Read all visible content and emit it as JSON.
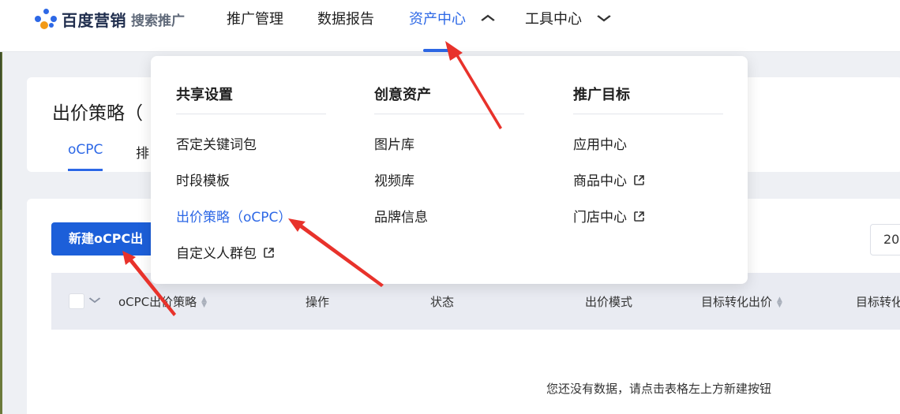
{
  "header": {
    "brand": "百度营销",
    "product": "搜索推广",
    "nav": [
      {
        "label": "推广管理",
        "active": false,
        "has_chevron": false,
        "chevron": ""
      },
      {
        "label": "数据报告",
        "active": false,
        "has_chevron": false,
        "chevron": ""
      },
      {
        "label": "资产中心",
        "active": true,
        "has_chevron": true,
        "chevron": "^"
      },
      {
        "label": "工具中心",
        "active": false,
        "has_chevron": true,
        "chevron": "v"
      }
    ]
  },
  "page": {
    "title": "出价策略（",
    "tabs": [
      {
        "label": "oCPC",
        "active": true
      },
      {
        "label": "排",
        "active": false
      }
    ]
  },
  "toolbar": {
    "new_button": "新建oCPC出",
    "pager_value": "20"
  },
  "table": {
    "headers": [
      {
        "label": "oCPC出价策略",
        "sortable": true
      },
      {
        "label": "操作",
        "sortable": false
      },
      {
        "label": "状态",
        "sortable": false
      },
      {
        "label": "出价模式",
        "sortable": false
      },
      {
        "label": "目标转化出价",
        "sortable": true
      },
      {
        "label": "目标转化",
        "sortable": false
      }
    ],
    "empty_text": "您还没有数据，请点击表格左上方新建按钮"
  },
  "dropdown": {
    "columns": [
      {
        "heading": "共享设置",
        "items": [
          {
            "label": "否定关键词包",
            "external": false,
            "selected": false
          },
          {
            "label": "时段模板",
            "external": false,
            "selected": false
          },
          {
            "label": "出价策略（oCPC）",
            "external": false,
            "selected": true
          },
          {
            "label": "自定义人群包",
            "external": true,
            "selected": false
          }
        ]
      },
      {
        "heading": "创意资产",
        "items": [
          {
            "label": "图片库",
            "external": false,
            "selected": false
          },
          {
            "label": "视频库",
            "external": false,
            "selected": false
          },
          {
            "label": "品牌信息",
            "external": false,
            "selected": false
          }
        ]
      },
      {
        "heading": "推广目标",
        "items": [
          {
            "label": "应用中心",
            "external": false,
            "selected": false
          },
          {
            "label": "商品中心",
            "external": true,
            "selected": false
          },
          {
            "label": "门店中心",
            "external": true,
            "selected": false
          }
        ]
      }
    ]
  },
  "colors": {
    "accent": "#2d68e6",
    "button": "#1c5fd9",
    "annotation_arrow": "#e8322b"
  },
  "icons": {
    "external_link": "external-link-icon",
    "sort": "sort-icon",
    "chevron_up": "chevron-up-icon",
    "chevron_down": "chevron-down-icon"
  }
}
